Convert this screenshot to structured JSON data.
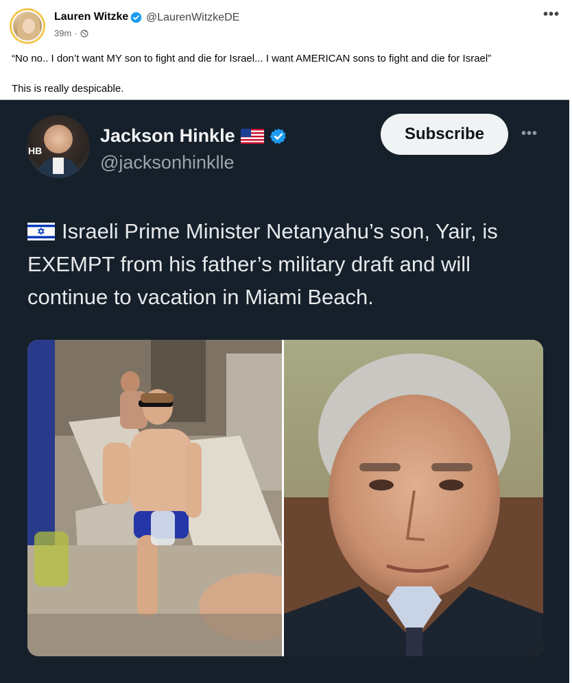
{
  "post": {
    "author_name": "Lauren Witzke",
    "author_handle": "@LaurenWitzkeDE",
    "time": "39m",
    "separator": "·",
    "body_line1": "“No no.. I don’t want MY son to fight and die for Israel... I want AMERICAN sons to fight and die for Israel”",
    "body_line2": "This is really despicable."
  },
  "embed": {
    "name": "Jackson Hinkle",
    "handle": "@jacksonhinklle",
    "subscribe_label": "Subscribe",
    "avatar_overlay_text": "HB",
    "tweet_text": "Israeli Prime Minister Netanyahu’s son, Yair, is EXEMPT from his father’s military draft and will continue to vacation in Miami Beach."
  },
  "icons": {
    "verified": "verified-badge-icon",
    "globe": "globe-icon",
    "more": "more-options-icon",
    "flag_us": "us-flag-icon",
    "flag_il": "israel-flag-icon"
  },
  "colors": {
    "verified_blue": "#1d9bf0",
    "embed_bg": "#15202b",
    "subscribe_bg": "#eff3f4"
  }
}
